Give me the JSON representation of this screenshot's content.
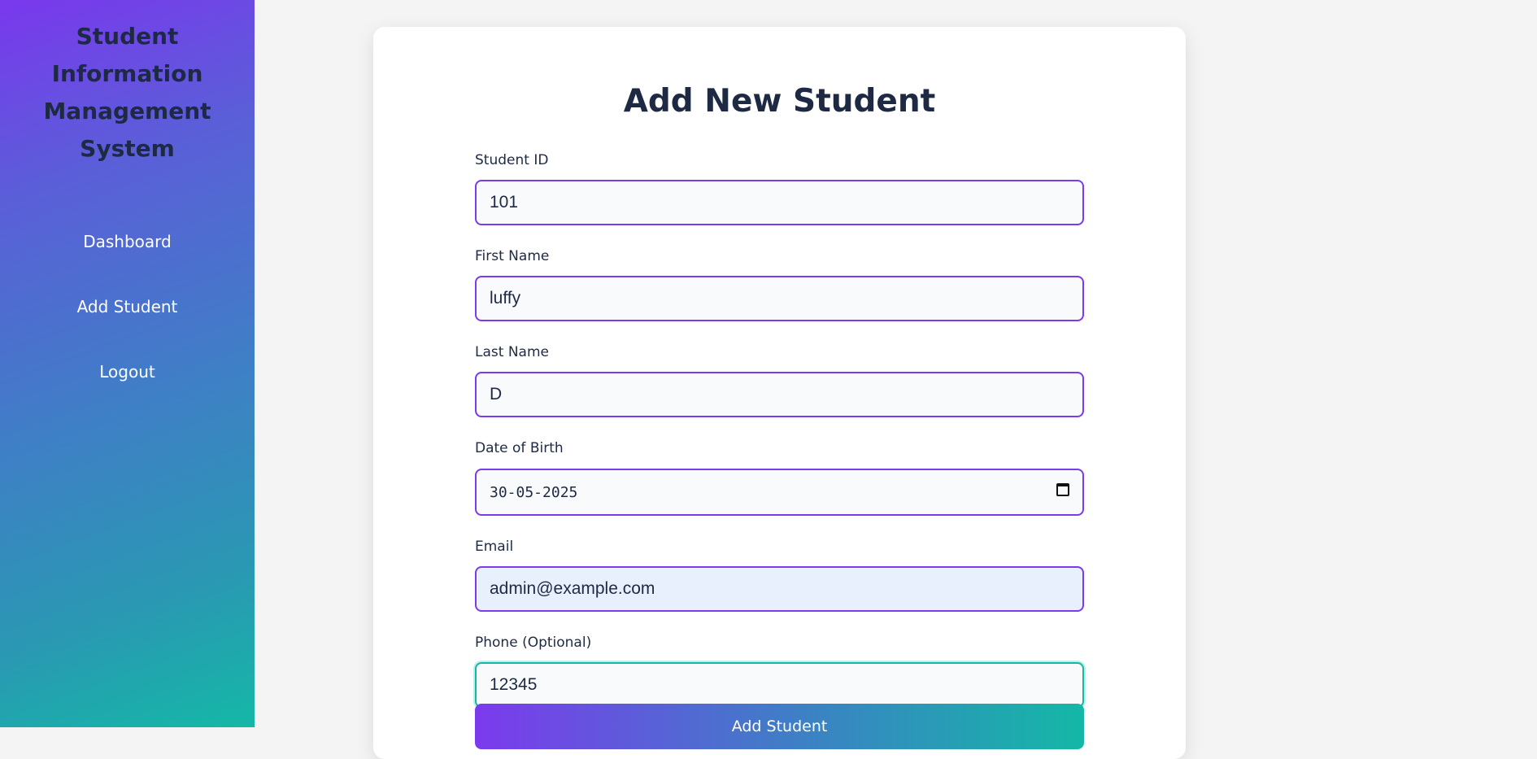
{
  "sidebar": {
    "title": "Student Information Management System",
    "items": [
      {
        "label": "Dashboard"
      },
      {
        "label": "Add Student"
      },
      {
        "label": "Logout"
      }
    ]
  },
  "form": {
    "title": "Add New Student",
    "fields": {
      "student_id": {
        "label": "Student ID",
        "value": "101"
      },
      "first_name": {
        "label": "First Name",
        "value": "luffy"
      },
      "last_name": {
        "label": "Last Name",
        "value": "D"
      },
      "dob": {
        "label": "Date of Birth",
        "value": "30-05-2025"
      },
      "email": {
        "label": "Email",
        "value": "admin@example.com"
      },
      "phone": {
        "label": "Phone (Optional)",
        "value": "12345"
      }
    },
    "submit_label": "Add Student"
  },
  "colors": {
    "accent": "#7c3aed",
    "focus": "#14b8a6",
    "heading": "#1e2a44"
  },
  "icons": {
    "date_picker": "calendar-icon"
  }
}
